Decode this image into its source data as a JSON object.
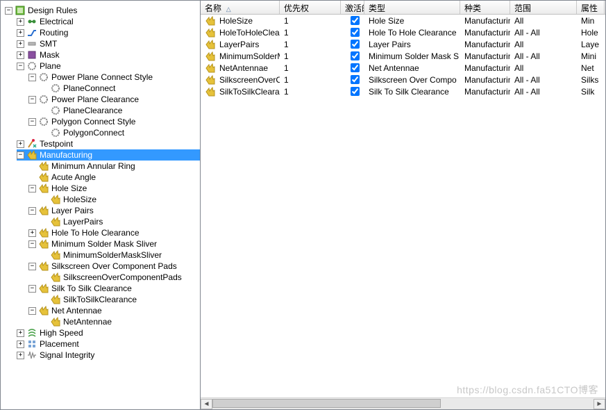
{
  "tree": {
    "root_label": "Design Rules",
    "electrical": "Electrical",
    "routing": "Routing",
    "smt": "SMT",
    "mask": "Mask",
    "plane": "Plane",
    "ppcs": "Power Plane Connect Style",
    "planeconnect": "PlaneConnect",
    "ppc": "Power Plane Clearance",
    "planeclearance": "PlaneClearance",
    "pcs": "Polygon Connect Style",
    "polygonconnect": "PolygonConnect",
    "testpoint": "Testpoint",
    "manufacturing": "Manufacturing",
    "mar": "Minimum Annular Ring",
    "acute": "Acute Angle",
    "holesize": "Hole Size",
    "holesize_rule": "HoleSize",
    "layerpairs": "Layer Pairs",
    "layerpairs_rule": "LayerPairs",
    "h2h": "Hole To Hole Clearance",
    "msms": "Minimum Solder Mask Sliver",
    "msms_rule": "MinimumSolderMaskSliver",
    "socp": "Silkscreen Over Component Pads",
    "socp_rule": "SilkscreenOverComponentPads",
    "s2s": "Silk To Silk Clearance",
    "s2s_rule": "SilkToSilkClearance",
    "netant": "Net Antennae",
    "netant_rule": "NetAntennae",
    "highspeed": "High Speed",
    "placement": "Placement",
    "si": "Signal Integrity"
  },
  "headers": {
    "name": "名称",
    "pri": "优先权",
    "en": "激活的",
    "type": "类型",
    "kind": "种类",
    "scope": "范围",
    "attr": "属性"
  },
  "rows": [
    {
      "name": "HoleSize",
      "pri": "1",
      "en": true,
      "type": "Hole Size",
      "kind": "Manufacturing",
      "scope": "All",
      "attr": "Min "
    },
    {
      "name": "HoleToHoleClearanc",
      "pri": "1",
      "en": true,
      "type": "Hole To Hole Clearance",
      "kind": "Manufacturing",
      "scope": "All    -    All",
      "attr": "Hole"
    },
    {
      "name": "LayerPairs",
      "pri": "1",
      "en": true,
      "type": "Layer Pairs",
      "kind": "Manufacturing",
      "scope": "All",
      "attr": "Laye"
    },
    {
      "name": "MinimumSolderMask",
      "pri": "1",
      "en": true,
      "type": "Minimum Solder Mask S",
      "kind": "Manufacturing",
      "scope": "All    -    All",
      "attr": "Mini"
    },
    {
      "name": "NetAntennae",
      "pri": "1",
      "en": true,
      "type": "Net Antennae",
      "kind": "Manufacturing",
      "scope": "All",
      "attr": "Net "
    },
    {
      "name": "SilkscreenOverComp",
      "pri": "1",
      "en": true,
      "type": "Silkscreen Over Compo",
      "kind": "Manufacturing",
      "scope": "All    -    All",
      "attr": "Silks"
    },
    {
      "name": "SilkToSilkClearance",
      "pri": "1",
      "en": true,
      "type": "Silk To Silk Clearance",
      "kind": "Manufacturing",
      "scope": "All    -    All",
      "attr": "Silk "
    }
  ],
  "watermark": "https://blog.csdn.fa51CTO博客"
}
